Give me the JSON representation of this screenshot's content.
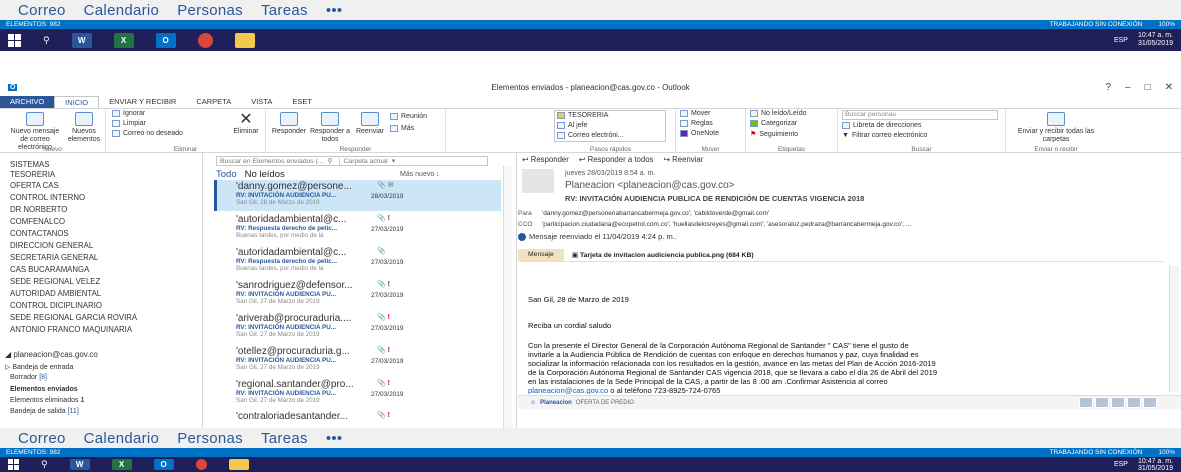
{
  "nav": {
    "items": [
      "Correo",
      "Calendario",
      "Personas",
      "Tareas",
      "•••"
    ]
  },
  "status": {
    "left": "ELEMENTOS: 982",
    "offline": "TRABAJANDO SIN CONEXIÓN",
    "zoom": "100%"
  },
  "taskbar": {
    "lang": "ESP",
    "time": "10:47 a. m.",
    "date": "31/05/2019"
  },
  "window": {
    "title": "Elementos enviados - planeacion@cas.gov.co - Outlook",
    "help": "?"
  },
  "tabs": [
    "ARCHIVO",
    "INICIO",
    "ENVIAR Y RECIBIR",
    "CARPETA",
    "VISTA",
    "ESET"
  ],
  "ribbon": {
    "nuevo": {
      "new_mail": "Nuevo mensaje de correo electrónico",
      "new_items": "Nuevos elementos",
      "label": "Nuevo"
    },
    "eliminar": {
      "ignore": "Ignorar",
      "clean": "Limpiar",
      "junk": "Correo no deseado",
      "delete": "Eliminar",
      "label": "Eliminar"
    },
    "responder": {
      "reply": "Responder",
      "reply_all": "Responder a todos",
      "forward": "Reenviar",
      "meeting": "Reunión",
      "more": "Más",
      "label": "Responder"
    },
    "pasos": {
      "s1": "TESORERIA",
      "s2": "Al jefe",
      "s3": "Correo electróni...",
      "label": "Pasos rápidos"
    },
    "mover": {
      "move": "Mover",
      "rules": "Reglas",
      "onenote": "OneNote",
      "label": "Mover"
    },
    "etiquetas": {
      "unread": "No leído/Leído",
      "categorize": "Categorizar",
      "followup": "Seguimiento",
      "label": "Etiquetas"
    },
    "buscar": {
      "placeholder": "Buscar personas",
      "address_book": "Libreta de direcciones",
      "filter": "Filtrar correo electrónico",
      "label": "Buscar"
    },
    "enviar": {
      "send_all": "Enviar y recibir todas las carpetas",
      "label": "Enviar o recibir"
    }
  },
  "folders": {
    "items": [
      "SISTEMAS",
      "TESORERIA",
      "OFERTA CAS",
      "CONTROL INTERNO",
      "DR NORBERTO",
      "COMFENALCO",
      "CONTACTANOS",
      "DIRECCION GENERAL",
      "SECRETARIA GENERAL",
      "CAS BUCARAMANGA",
      "SEDE REGIONAL  VELEZ",
      "AUTORIDAD AMBIENTAL",
      "CONTROL DICIPLINARIO",
      "SEDE REGIONAL GARCIA ROVIRA",
      "ANTONIO FRANCO MAQUINARIA"
    ],
    "account": "planeacion@cas.gov.co",
    "inbox": "Bandeja de entrada",
    "drafts": "Borrador",
    "drafts_count": "[8]",
    "sent": "Elementos enviados",
    "deleted": "Elementos eliminados",
    "deleted_count": "1",
    "outbox": "Bandeja de salida",
    "outbox_count": "[11]"
  },
  "list": {
    "search_placeholder": "Buscar en Elementos enviados (...",
    "scope": "Carpeta actual",
    "filter_all": "Todo",
    "filter_unread": "No leídos",
    "sort": "Más nuevo ↓",
    "items": [
      {
        "from": "'danny.gomez@persone...",
        "subject": "RV: INVITACIÓN AUDIENCIA PU...",
        "preview": "San Gil, 28 de Marzo de 2019",
        "date": "28/03/2019",
        "icons": "📎 ✉",
        "flag": ""
      },
      {
        "from": "'autoridadambiental@c...",
        "subject": "RV: Respuesta derecho de petic...",
        "preview": "Buenas tardes,  por medio de la",
        "date": "27/03/2019",
        "icons": "📎",
        "flag": "!"
      },
      {
        "from": "'autoridadambiental@c...",
        "subject": "RV: Respuesta derecho de petic...",
        "preview": "Buenas tardes,  por medio de la",
        "date": "27/03/2019",
        "icons": "📎",
        "flag": ""
      },
      {
        "from": "'sanrodriguez@defensor...",
        "subject": "RV: INVITACIÓN AUDIENCIA PU...",
        "preview": "San Gil, 27 de Marzo de 2019",
        "date": "27/03/2019",
        "icons": "📎",
        "flag": "!"
      },
      {
        "from": "'ariverab@procuraduria....",
        "subject": "RV: INVITACIÓN AUDIENCIA PU...",
        "preview": "San Gil, 27 de Marzo de 2019",
        "date": "27/03/2019",
        "icons": "📎",
        "flag": "!"
      },
      {
        "from": "'otellez@procuraduria.g...",
        "subject": "RV: INVITACIÓN AUDIENCIA PU...",
        "preview": "San Gil, 27 de Marzo de 2019",
        "date": "27/03/2019",
        "icons": "📎",
        "flag": "!"
      },
      {
        "from": "'regional.santander@pro...",
        "subject": "RV: INVITACIÓN AUDIENCIA PU...",
        "preview": "San Gil, 27 de Marzo de 2019",
        "date": "27/03/2019",
        "icons": "📎",
        "flag": "!"
      },
      {
        "from": "'contraloriadesantander...",
        "subject": "",
        "preview": "",
        "date": "",
        "icons": "📎",
        "flag": "!"
      }
    ]
  },
  "reader": {
    "reply": "Responder",
    "reply_all": "Responder a todos",
    "forward": "Reenviar",
    "date": "jueves 28/03/2019 8:54 a. m.",
    "sender": "Planeacion <planeacion@cas.gov.co>",
    "subject": "RV: INVITACIÓN AUDIENCIA PUBLICA DE RENDICIÓN  DE CUENTAS VIGENCIA 2018",
    "para_label": "Para",
    "para": "'danny.gomez@personeriabarrancabermeja.gov.co'; 'cabildoverde@gmail.com'",
    "cco_label": "CCO",
    "cco": "'participacion.ciudadana@ecopetrol.com.co'; 'huellasdelosreyes@gmail.com'; 'asesoraluz.pedraza@barrancabermeja.gov.co'; ...",
    "forwarded": "Mensaje reenviado el 11/04/2019 4:24 p. m..",
    "tab_msg": "Mensaje",
    "attachment": "Tarjeta de invitacion  audiciencia publica.png (684 KB)",
    "body_date": "San Gil, 28 de Marzo de 2019",
    "greeting": "Reciba un cordial saludo",
    "body_1": "Con la presente el Director General  de la Corporación Autónoma Regional de Santander  \" CAS\" tiene el gusto de",
    "body_2": "invitarle a la Audiencia Pública de Rendición de cuentas con enfoque en derechos humanos y paz, cuya finalidad es",
    "body_3": "socializar la información relacionada con los resultados en la gestión, avance en las metas del Plan de Acción 2016-2019",
    "body_4": "de la Corporación Autónoma Regional de Santander CAS vigencia 2018, que se llevara a cabo el día 26  de Abril  del 2019",
    "body_5": "en las instalaciones de la Sede Principal de la CAS, a partir de las 8 :00 am .Confirmar Asistencia  al correo",
    "body_link": "planeacion@cas.gov.co",
    "body_6": " o al teléfono 723-8925-724-0765",
    "people_bar": "Planeacion",
    "people_bar_sub": "OFERTA DE PREDIO"
  },
  "colors": {
    "accent": "#2b579a",
    "statusbar": "#0072c6",
    "taskbar": "#1f1f5a",
    "selected": "#cde6f7"
  }
}
